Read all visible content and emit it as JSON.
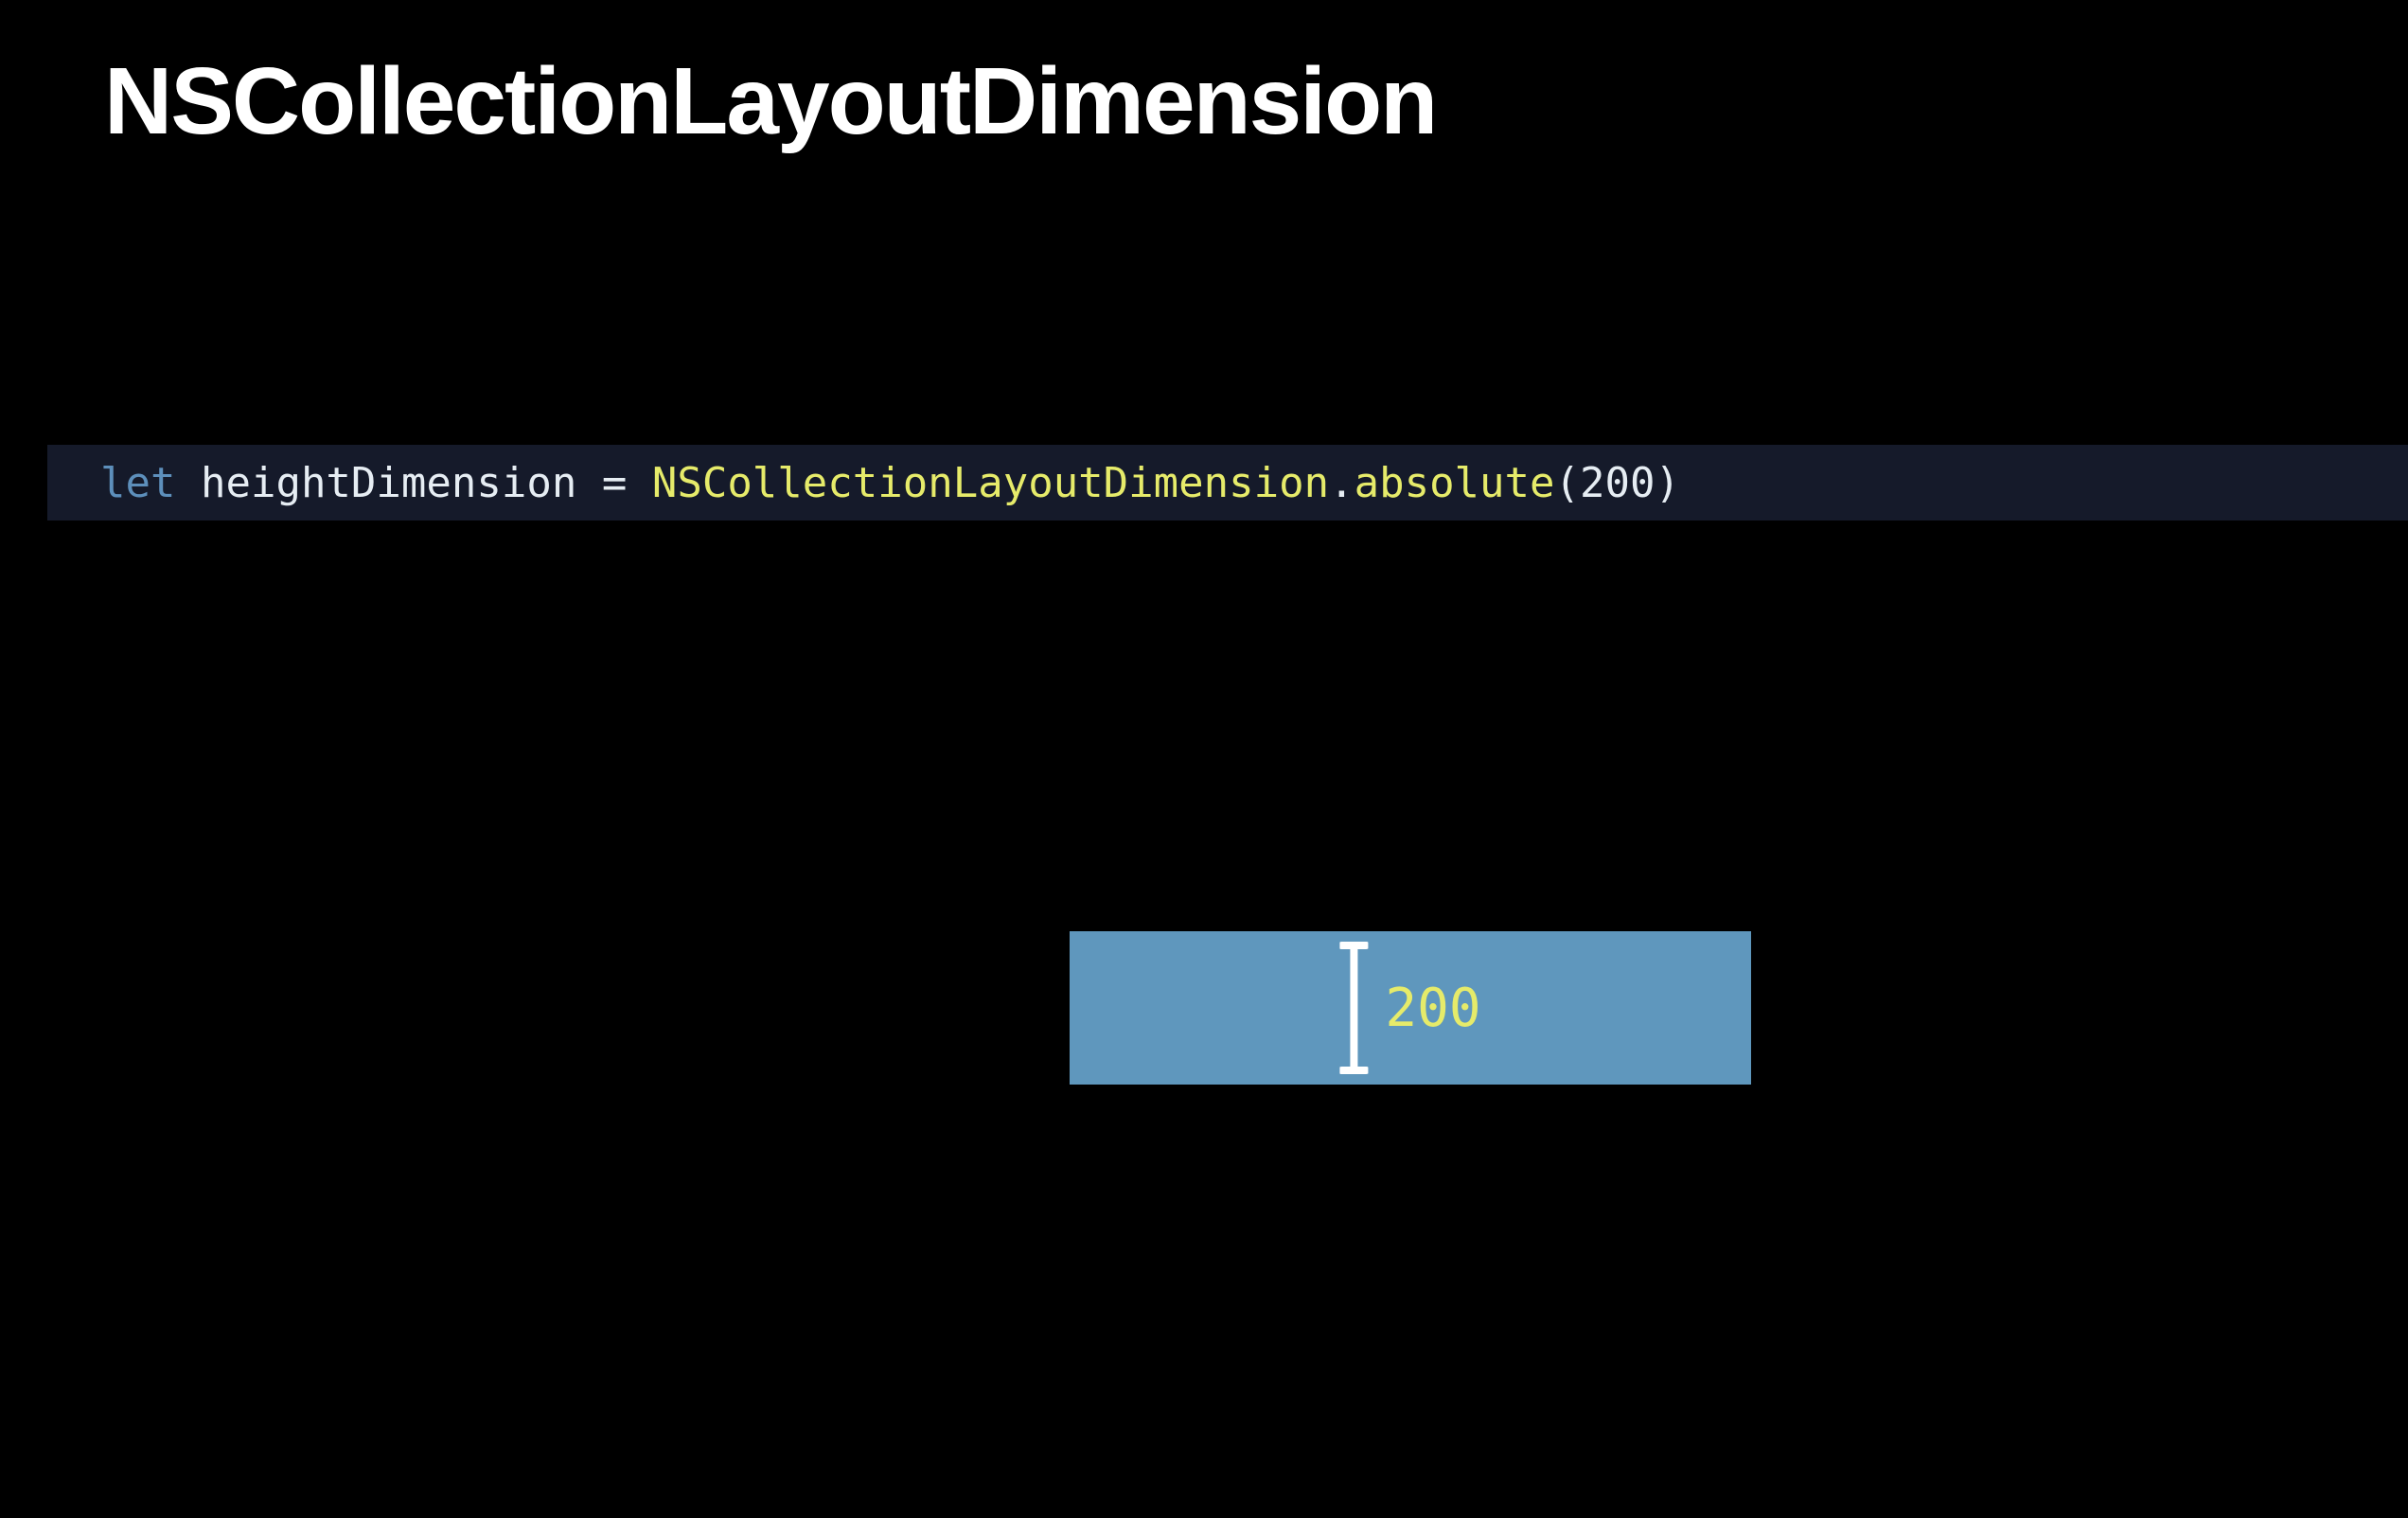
{
  "title": "NSCollectionLayoutDimension",
  "code": {
    "keyword": "let",
    "space1": " ",
    "ident": "heightDimension",
    "space2": " ",
    "equals": "=",
    "space3": " ",
    "type": "NSCollectionLayoutDimension",
    "dot": ".",
    "method": "absolute",
    "lparen": "(",
    "arg": "200",
    "rparen": ")"
  },
  "illustration": {
    "value_label": "200",
    "colors": {
      "box": "#5f97bd",
      "label": "#e6eb6a",
      "beam": "#ffffff"
    }
  }
}
